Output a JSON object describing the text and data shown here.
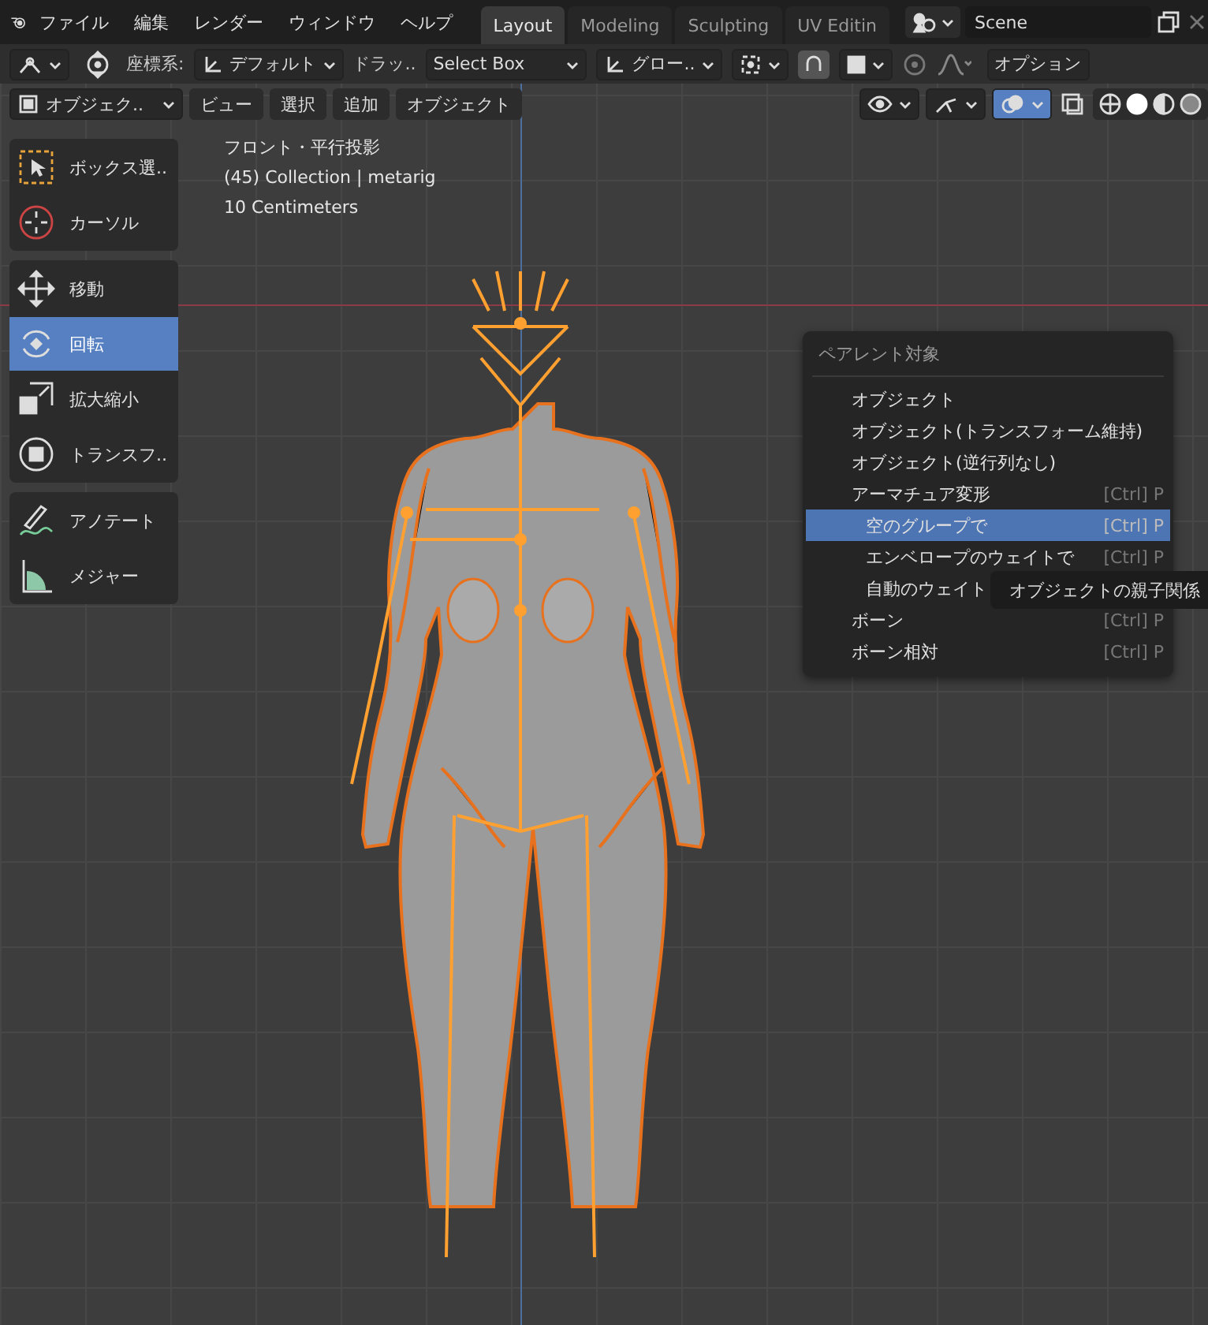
{
  "top_bar": {
    "menus": [
      "ファイル",
      "編集",
      "レンダー",
      "ウィンドウ",
      "ヘルプ"
    ],
    "workspace_tabs": [
      {
        "label": "Layout",
        "selected": true
      },
      {
        "label": "Modeling",
        "selected": false
      },
      {
        "label": "Sculpting",
        "selected": false
      },
      {
        "label": "UV Editin",
        "selected": false
      }
    ],
    "scene": "Scene"
  },
  "tool_header": {
    "coordinate_label": "座標系:",
    "orientation": "デフォルト",
    "drag_label": "ドラッ..",
    "drag_value": "Select Box",
    "transform_orientation": "グロー..",
    "options": "オプション"
  },
  "viewport_header": {
    "mode": "オブジェク..",
    "menus": [
      "ビュー",
      "選択",
      "追加",
      "オブジェクト"
    ]
  },
  "toolbar": {
    "groups": [
      [
        {
          "kind": "select-box",
          "label": "ボックス選..",
          "selected": false
        },
        {
          "kind": "cursor",
          "label": "カーソル",
          "selected": false
        }
      ],
      [
        {
          "kind": "move",
          "label": "移動",
          "selected": false
        },
        {
          "kind": "rotate",
          "label": "回転",
          "selected": true
        },
        {
          "kind": "scale",
          "label": "拡大縮小",
          "selected": false
        },
        {
          "kind": "transform",
          "label": "トランスフ..",
          "selected": false
        }
      ],
      [
        {
          "kind": "annotate",
          "label": "アノテート",
          "selected": false
        },
        {
          "kind": "measure",
          "label": "メジャー",
          "selected": false
        }
      ]
    ]
  },
  "viewport_info": [
    "フロント・平行投影",
    "(45) Collection | metarig",
    "10 Centimeters"
  ],
  "parent_menu": {
    "title": "ペアレント対象",
    "items": [
      {
        "label": "オブジェクト",
        "selected": false
      },
      {
        "label": "オブジェクト(トランスフォーム維持)",
        "selected": false
      },
      {
        "label": "オブジェクト(逆行列なし)",
        "selected": false
      },
      {
        "label": "アーマチュア変形",
        "shortcut": "[Ctrl] P",
        "selected": false,
        "children": [
          {
            "label": "空のグループで",
            "shortcut": "[Ctrl] P",
            "selected": true
          },
          {
            "label": "エンベロープのウェイトで",
            "shortcut": "[Ctrl] P",
            "selected": false
          },
          {
            "label": "自動のウェイト",
            "selected": false
          }
        ]
      },
      {
        "label": "ボーン",
        "shortcut": "[Ctrl] P",
        "selected": false
      },
      {
        "label": "ボーン相対",
        "shortcut": "[Ctrl] P",
        "selected": false
      }
    ]
  },
  "tooltip": {
    "text": "オブジェクトの親子関係"
  }
}
